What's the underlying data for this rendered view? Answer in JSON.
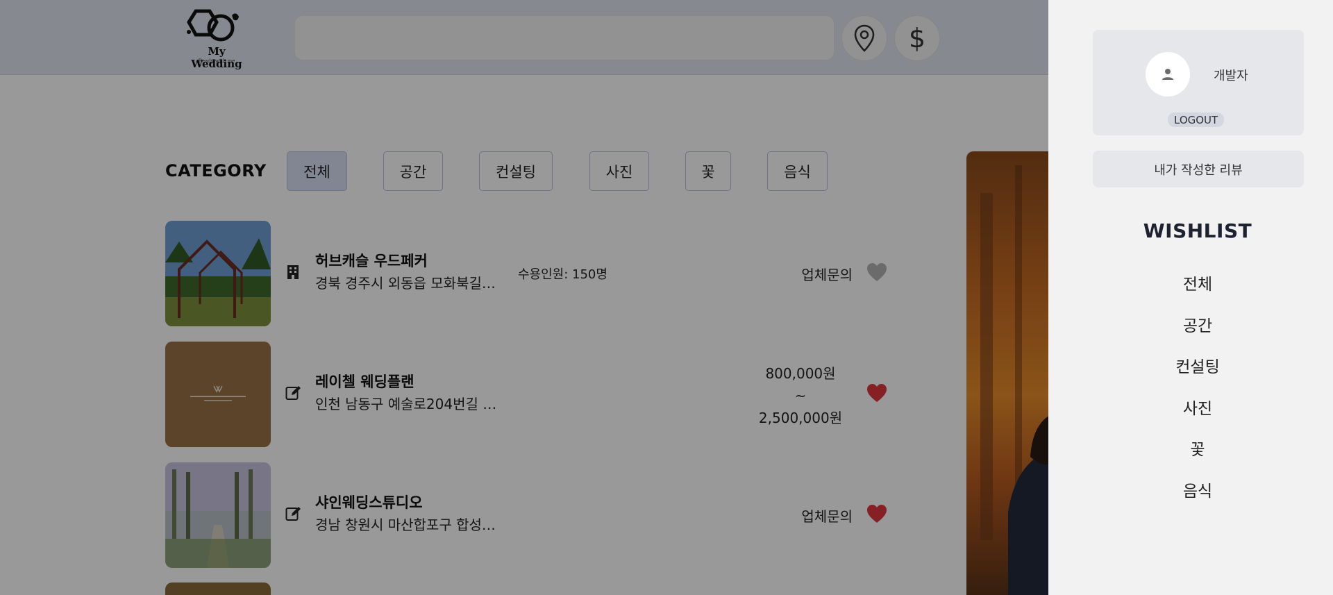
{
  "header": {
    "logo_title": "My Wedding",
    "logo_subtitle": "Ready with me",
    "search_placeholder": "",
    "location_icon": "map-pin-icon",
    "price_icon": "dollar-icon",
    "price_glyph": "$"
  },
  "category": {
    "label": "CATEGORY",
    "active": "전체",
    "tabs": [
      "전체",
      "공간",
      "컨설팅",
      "사진",
      "꽃",
      "음식"
    ]
  },
  "items": [
    {
      "name": "허브캐슬 우드페커",
      "address": "경북 경주시 외동읍 모화북길 …",
      "capacity": "수용인원: 150명",
      "price": "업체문의",
      "type_icon": "building-icon",
      "wishlisted": false
    },
    {
      "name": "레이첼 웨딩플랜",
      "address": "인천 남동구 예술로204번길 …",
      "price_min": "800,000원",
      "price_sep": "~",
      "price_max": "2,500,000원",
      "type_icon": "edit-icon",
      "wishlisted": true
    },
    {
      "name": "샤인웨딩스튜디오",
      "address": "경남 창원시 마산합포구 합성 …",
      "price": "업체문의",
      "type_icon": "edit-icon",
      "wishlisted": true
    }
  ],
  "drawer": {
    "username": "개발자",
    "logout_label": "LOGOUT",
    "review_label": "내가 작성한 리뷰",
    "wishlist_title": "WISHLIST",
    "wishlist_items": [
      "전체",
      "공간",
      "컨설팅",
      "사진",
      "꽃",
      "음식"
    ]
  },
  "colors": {
    "header_bg": "#dfe4f0",
    "active_tab_bg": "#d9dff5",
    "tab_border": "#b6c0dc",
    "heart_active": "#e0363f",
    "heart_inactive": "#b3b3b3",
    "drawer_bg": "#f2f2f2",
    "overlay": "rgba(0,0,0,0.40)"
  }
}
